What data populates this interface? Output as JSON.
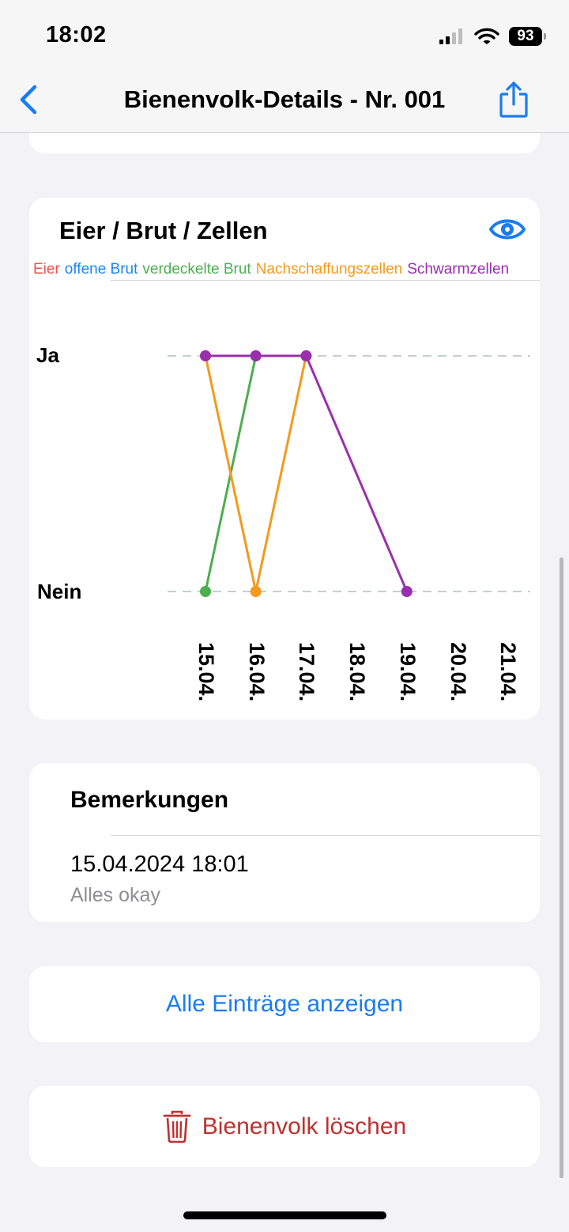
{
  "status": {
    "time": "18:02",
    "battery": "93"
  },
  "nav": {
    "title": "Bienenvolk-Details - Nr. 001"
  },
  "chart_card": {
    "title": "Eier / Brut / Zellen",
    "legend": [
      {
        "label": "Eier",
        "color": "#f0524a"
      },
      {
        "label": "offene Brut",
        "color": "#1a87f2"
      },
      {
        "label": "verdeckelte Brut",
        "color": "#4cae4f"
      },
      {
        "label": "Nachschaffungszellen",
        "color": "#f39a1c"
      },
      {
        "label": "Schwarmzellen",
        "color": "#9a2fae"
      }
    ]
  },
  "chart_data": {
    "type": "line",
    "categories": [
      "15.04.",
      "16.04.",
      "17.04.",
      "18.04.",
      "19.04.",
      "20.04.",
      "21.04."
    ],
    "y_levels": [
      "Nein",
      "Ja"
    ],
    "grid": "dashed horizontal at Ja and Nein",
    "series": [
      {
        "name": "verdeckelte Brut",
        "color": "#4cae4f",
        "points": [
          [
            "15.04.",
            "Nein"
          ],
          [
            "16.04.",
            "Ja"
          ]
        ]
      },
      {
        "name": "Nachschaffungszellen",
        "color": "#f39a1c",
        "points": [
          [
            "15.04.",
            "Ja"
          ],
          [
            "16.04.",
            "Nein"
          ],
          [
            "17.04.",
            "Ja"
          ]
        ]
      },
      {
        "name": "Schwarmzellen",
        "color": "#9a2fae",
        "points": [
          [
            "15.04.",
            "Ja"
          ],
          [
            "16.04.",
            "Ja"
          ],
          [
            "17.04.",
            "Ja"
          ],
          [
            "19.04.",
            "Nein"
          ]
        ]
      }
    ]
  },
  "remarks": {
    "title": "Bemerkungen",
    "entries": [
      {
        "date": "15.04.2024 18:01",
        "text": "Alles okay"
      }
    ]
  },
  "actions": {
    "show_all": "Alle Einträge anzeigen",
    "delete": "Bienenvolk löschen"
  },
  "colors": {
    "accent": "#1a7cf0",
    "destructive": "#c0312f"
  }
}
